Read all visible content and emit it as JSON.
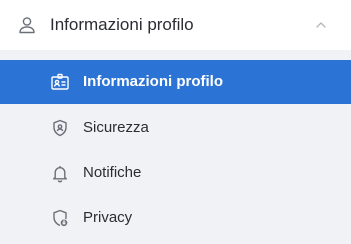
{
  "header": {
    "title": "Informazioni profilo",
    "icon": "user-icon",
    "expand_icon": "chevron-up-icon"
  },
  "menu": {
    "items": [
      {
        "label": "Informazioni profilo",
        "icon": "id-card-icon",
        "active": true
      },
      {
        "label": "Sicurezza",
        "icon": "shield-icon",
        "active": false
      },
      {
        "label": "Notifiche",
        "icon": "bell-icon",
        "active": false
      },
      {
        "label": "Privacy",
        "icon": "shield-lock-icon",
        "active": false
      }
    ]
  },
  "colors": {
    "active_bg": "#2c73d6",
    "text": "#2b2d33",
    "icon": "#6b7078",
    "background": "#f1f2f5",
    "header_bg": "#ffffff"
  }
}
